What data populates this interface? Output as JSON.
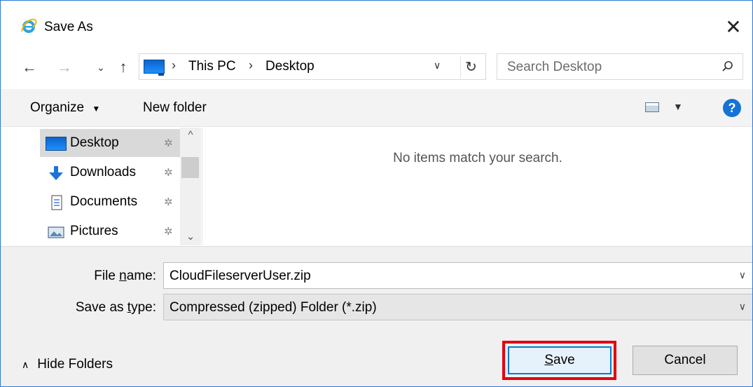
{
  "window": {
    "title": "Save As"
  },
  "address": {
    "crumbs": [
      "This PC",
      "Desktop"
    ]
  },
  "search": {
    "placeholder": "Search Desktop"
  },
  "toolbar": {
    "organize_label": "Organize",
    "new_folder_label": "New folder"
  },
  "sidebar": {
    "items": [
      {
        "label": "Desktop",
        "icon": "desktop-icon",
        "selected": true
      },
      {
        "label": "Downloads",
        "icon": "downloads-icon",
        "selected": false
      },
      {
        "label": "Documents",
        "icon": "documents-icon",
        "selected": false
      },
      {
        "label": "Pictures",
        "icon": "pictures-icon",
        "selected": false
      }
    ]
  },
  "content": {
    "empty_message": "No items match your search."
  },
  "form": {
    "file_name_label_pre": "File ",
    "file_name_label_ul": "n",
    "file_name_label_post": "ame:",
    "file_name_value": "CloudFileserverUser.zip",
    "save_type_label_pre": "Save as ",
    "save_type_label_ul": "t",
    "save_type_label_post": "ype:",
    "save_type_value": "Compressed (zipped) Folder (*.zip)"
  },
  "footer": {
    "hide_folders_label": "Hide Folders",
    "save_label_ul": "S",
    "save_label_post": "ave",
    "cancel_label": "Cancel"
  },
  "colors": {
    "accent": "#0b79d3",
    "highlight": "#e3000f",
    "window_border": "#2b79d6"
  }
}
